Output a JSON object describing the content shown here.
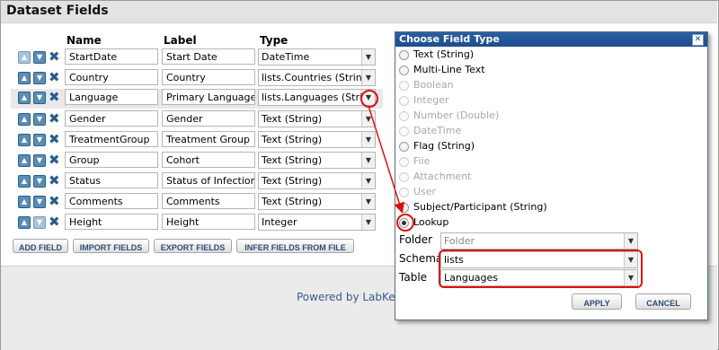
{
  "panel": {
    "title": "Dataset Fields"
  },
  "columns": {
    "name": "Name",
    "label": "Label",
    "type": "Type"
  },
  "fields": [
    {
      "name": "StartDate",
      "label": "Start Date",
      "type": "DateTime"
    },
    {
      "name": "Country",
      "label": "Country",
      "type": "lists.Countries (String)"
    },
    {
      "name": "Language",
      "label": "Primary Language",
      "type": "lists.Languages (String)"
    },
    {
      "name": "Gender",
      "label": "Gender",
      "type": "Text (String)"
    },
    {
      "name": "TreatmentGroup",
      "label": "Treatment Group",
      "type": "Text (String)"
    },
    {
      "name": "Group",
      "label": "Cohort",
      "type": "Text (String)"
    },
    {
      "name": "Status",
      "label": "Status of Infection",
      "type": "Text (String)"
    },
    {
      "name": "Comments",
      "label": "Comments",
      "type": "Text (String)"
    },
    {
      "name": "Height",
      "label": "Height",
      "type": "Integer"
    }
  ],
  "buttons": {
    "add_field": "ADD FIELD",
    "import_fields": "IMPORT FIELDS",
    "export_fields": "EXPORT FIELDS",
    "infer_fields": "INFER FIELDS FROM FILE"
  },
  "footer": {
    "powered_by": "Powered by LabKey"
  },
  "dialog": {
    "title": "Choose Field Type",
    "options": [
      {
        "label": "Text (String)",
        "enabled": true,
        "selected": false
      },
      {
        "label": "Multi-Line Text",
        "enabled": true,
        "selected": false
      },
      {
        "label": "Boolean",
        "enabled": false,
        "selected": false
      },
      {
        "label": "Integer",
        "enabled": false,
        "selected": false
      },
      {
        "label": "Number (Double)",
        "enabled": false,
        "selected": false
      },
      {
        "label": "DateTime",
        "enabled": false,
        "selected": false
      },
      {
        "label": "Flag (String)",
        "enabled": true,
        "selected": false
      },
      {
        "label": "File",
        "enabled": false,
        "selected": false
      },
      {
        "label": "Attachment",
        "enabled": false,
        "selected": false
      },
      {
        "label": "User",
        "enabled": false,
        "selected": false
      },
      {
        "label": "Subject/Participant (String)",
        "enabled": true,
        "selected": false
      },
      {
        "label": "Lookup",
        "enabled": true,
        "selected": true
      }
    ],
    "folder_label": "Folder",
    "folder_value": "Folder",
    "schema_label": "Schema",
    "schema_value": "lists",
    "table_label": "Table",
    "table_value": "Languages",
    "apply": "APPLY",
    "cancel": "CANCEL"
  },
  "colors": {
    "dialog_header": "#1e4d8e",
    "callout": "#dd1111",
    "icon_blue": "#2a5d8e"
  }
}
